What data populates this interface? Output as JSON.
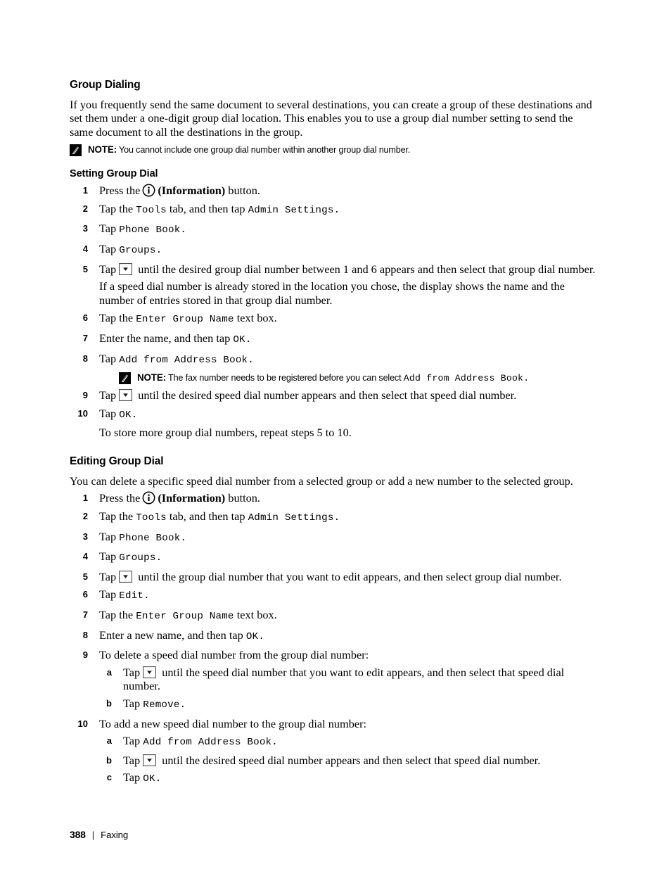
{
  "page": {
    "footer_page_number": "388",
    "footer_separator": "|",
    "footer_chapter": "Faxing"
  },
  "group_dialing": {
    "heading": "Group Dialing",
    "intro": "If you frequently send the same document to several destinations, you can create a group of these destinations and set them under a one-digit group dial location. This enables you to use a group dial number setting to send the same document to all the destinations in the group.",
    "note": {
      "label": "NOTE:",
      "text": "You cannot include one group dial number within another group dial number."
    }
  },
  "setting_group_dial": {
    "heading": "Setting Group Dial",
    "steps": [
      {
        "num": "1",
        "before_icon": "Press the",
        "icon": "information-icon",
        "after_icon_bold": "(Information)",
        "tail": "button."
      },
      {
        "num": "2",
        "pre": "Tap the",
        "ui1": "Tools",
        "mid": "tab, and then tap",
        "ui2": "Admin Settings",
        "tail": "."
      },
      {
        "num": "3",
        "pre": "Tap",
        "ui1": "Phone Book",
        "tail": "."
      },
      {
        "num": "4",
        "pre": "Tap",
        "ui1": "Groups",
        "tail": "."
      },
      {
        "num": "5",
        "pre": "Tap",
        "icon": "dropdown-down-arrow-icon",
        "post": "until the desired group dial number between 1 and 6 appears and then select that group dial number.",
        "extra": "If a speed dial number is already stored in the location you chose, the display shows the name and the number of entries stored in that group dial number."
      },
      {
        "num": "6",
        "pre": "Tap the",
        "ui1": "Enter Group Name",
        "tail": "text box."
      },
      {
        "num": "7",
        "pre": "Enter the name, and then tap",
        "ui1": "OK",
        "tail": "."
      },
      {
        "num": "8",
        "pre": "Tap",
        "ui1": "Add from Address Book",
        "tail": ".",
        "note": {
          "label": "NOTE:",
          "text_before": "The fax number needs to be registered before you can select",
          "ui": "Add from Address Book",
          "text_after": "."
        }
      },
      {
        "num": "9",
        "pre": "Tap",
        "icon": "dropdown-down-arrow-icon",
        "post": "until the desired speed dial number appears and then select that speed dial number."
      },
      {
        "num": "10",
        "pre": "Tap",
        "ui1": "OK",
        "tail": ".",
        "extra": "To store more group dial numbers, repeat steps 5 to 10."
      }
    ]
  },
  "editing_group_dial": {
    "heading": "Editing Group Dial",
    "intro": "You can delete a specific speed dial number from a selected group or add a new number to the selected group.",
    "steps": [
      {
        "num": "1",
        "before_icon": "Press the",
        "icon": "information-icon",
        "after_icon_bold": "(Information)",
        "tail": "button."
      },
      {
        "num": "2",
        "pre": "Tap the",
        "ui1": "Tools",
        "mid": "tab, and then tap",
        "ui2": "Admin Settings",
        "tail": "."
      },
      {
        "num": "3",
        "pre": "Tap",
        "ui1": "Phone Book",
        "tail": "."
      },
      {
        "num": "4",
        "pre": "Tap",
        "ui1": "Groups",
        "tail": "."
      },
      {
        "num": "5",
        "pre": "Tap",
        "icon": "dropdown-down-arrow-icon",
        "post": "until the group dial number that you want to edit appears, and then select group dial number."
      },
      {
        "num": "6",
        "pre": "Tap",
        "ui1": "Edit",
        "tail": "."
      },
      {
        "num": "7",
        "pre": "Tap the",
        "ui1": "Enter Group Name",
        "tail": "text box."
      },
      {
        "num": "8",
        "pre": "Enter a new name, and then tap",
        "ui1": "OK",
        "tail": "."
      },
      {
        "num": "9",
        "lead": "To delete a speed dial number from the group dial number:",
        "substeps": [
          {
            "num": "a",
            "pre": "Tap",
            "icon": "dropdown-down-arrow-icon",
            "post": "until the speed dial number that you want to edit appears, and then select that speed dial number."
          },
          {
            "num": "b",
            "pre": "Tap",
            "ui1": "Remove",
            "tail": "."
          }
        ]
      },
      {
        "num": "10",
        "lead": "To add a new speed dial number to the group dial number:",
        "substeps": [
          {
            "num": "a",
            "pre": "Tap",
            "ui1": "Add from Address Book",
            "tail": "."
          },
          {
            "num": "b",
            "pre": "Tap",
            "icon": "dropdown-down-arrow-icon",
            "post": "until the desired speed dial number appears and then select that speed dial number."
          },
          {
            "num": "c",
            "pre": "Tap",
            "ui1": "OK",
            "tail": "."
          }
        ]
      }
    ]
  },
  "colors": {
    "text": "#000000",
    "background": "#ffffff",
    "note_icon_bg": "#000000"
  }
}
